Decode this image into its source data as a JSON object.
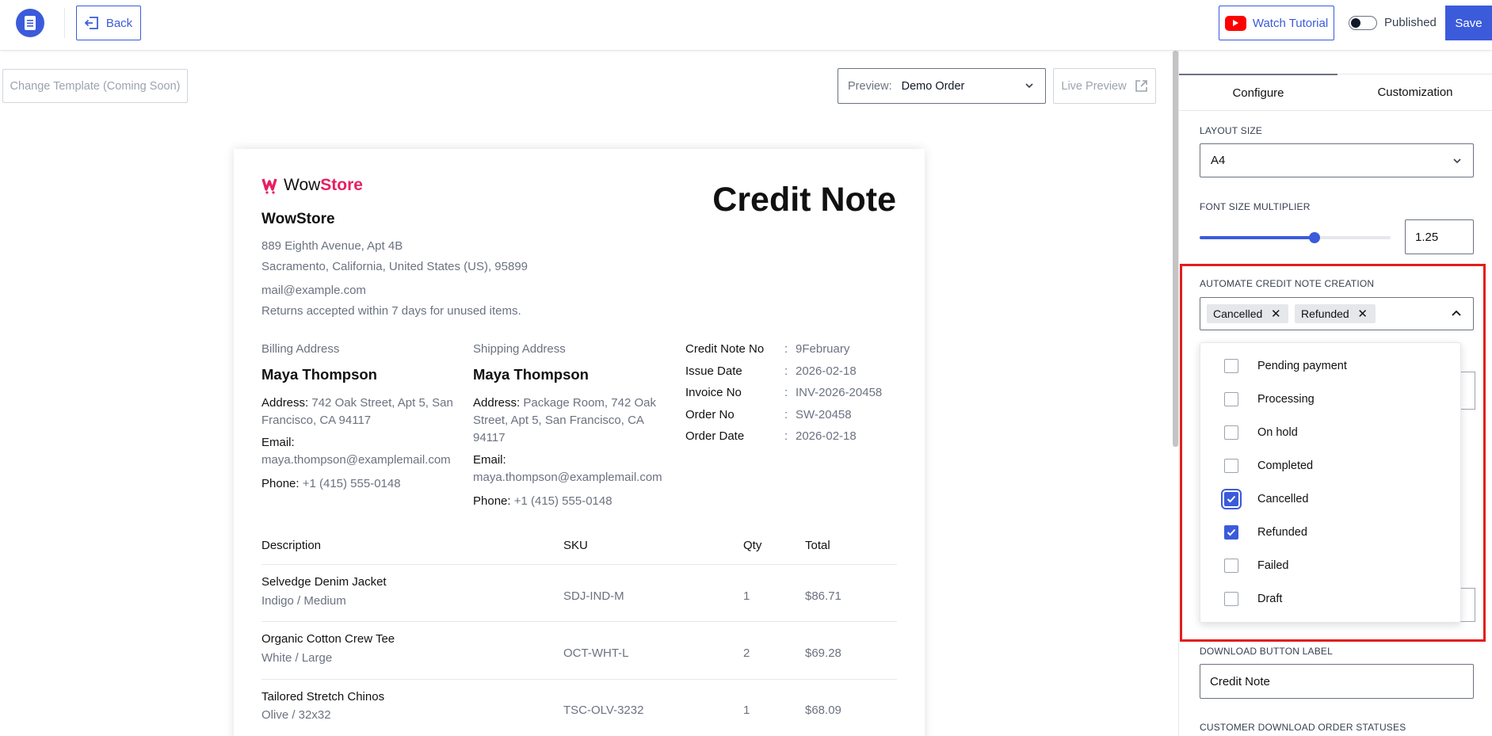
{
  "topbar": {
    "back_label": "Back",
    "watch_tutorial_label": "Watch Tutorial",
    "published_label": "Published",
    "save_label": "Save"
  },
  "toolbar": {
    "change_template_label": "Change Template (Coming Soon)",
    "preview_label": "Preview:",
    "preview_value": "Demo Order",
    "live_preview_label": "Live Preview"
  },
  "document": {
    "brand_prefix": "Wow",
    "brand_suffix": "Store",
    "title": "Credit Note",
    "store_name": "WowStore",
    "address_line1": "889 Eighth Avenue, Apt 4B",
    "address_line2": "Sacramento, California, United States (US), 95899",
    "email": "mail@example.com",
    "note": "Returns accepted within 7 days for unused items.",
    "billing": {
      "heading": "Billing Address",
      "name": "Maya Thompson",
      "address_key": "Address:",
      "address_line1": "742 Oak Street, Apt 5, San",
      "address_line2": "Francisco, CA 94117",
      "email_key": "Email:",
      "email": "maya.thompson@examplemail.com",
      "phone_key": "Phone:",
      "phone": "+1 (415) 555-0148"
    },
    "shipping": {
      "heading": "Shipping Address",
      "name": "Maya Thompson",
      "address_key": "Address:",
      "address_line1": "Package Room, 742 Oak",
      "address_line2": "Street, Apt 5, San Francisco, CA",
      "address_line3": "94117",
      "email_key": "Email:",
      "email": "maya.thompson@examplemail.com",
      "phone_key": "Phone:",
      "phone": "+1 (415) 555-0148"
    },
    "meta": [
      {
        "label": "Credit Note No",
        "sep": ":",
        "value": "9February"
      },
      {
        "label": "Issue Date",
        "sep": ":",
        "value": "2026-02-18"
      },
      {
        "label": "Invoice No",
        "sep": ":",
        "value": "INV-2026-20458"
      },
      {
        "label": "Order No",
        "sep": ":",
        "value": "SW-20458"
      },
      {
        "label": "Order Date",
        "sep": ":",
        "value": "2026-02-18"
      }
    ],
    "table": {
      "headers": [
        "Description",
        "SKU",
        "Qty",
        "Total"
      ],
      "rows": [
        {
          "name": "Selvedge Denim Jacket",
          "variant": "Indigo / Medium",
          "sku": "SDJ-IND-M",
          "qty": "1",
          "total": "$86.71"
        },
        {
          "name": "Organic Cotton Crew Tee",
          "variant": "White / Large",
          "sku": "OCT-WHT-L",
          "qty": "2",
          "total": "$69.28"
        },
        {
          "name": "Tailored Stretch Chinos",
          "variant": "Olive / 32x32",
          "sku": "TSC-OLV-3232",
          "qty": "1",
          "total": "$68.09"
        }
      ]
    }
  },
  "panel": {
    "tabs": [
      {
        "label": "Configure"
      },
      {
        "label": "Customization"
      }
    ],
    "layout_size_label": "LAYOUT SIZE",
    "layout_size_value": "A4",
    "font_size_label": "FONT SIZE MULTIPLIER",
    "font_size_value": "1.25",
    "font_size_slider_fraction": 0.6,
    "automate_label": "AUTOMATE CREDIT NOTE CREATION",
    "selected_chips": [
      "Cancelled",
      "Refunded"
    ],
    "status_options": [
      {
        "label": "Pending payment",
        "checked": false
      },
      {
        "label": "Processing",
        "checked": false
      },
      {
        "label": "On hold",
        "checked": false
      },
      {
        "label": "Completed",
        "checked": false
      },
      {
        "label": "Cancelled",
        "checked": true
      },
      {
        "label": "Refunded",
        "checked": true
      },
      {
        "label": "Failed",
        "checked": false
      },
      {
        "label": "Draft",
        "checked": false
      }
    ],
    "download_label": "DOWNLOAD BUTTON LABEL",
    "download_value": "Credit Note",
    "customer_statuses_label": "CUSTOMER DOWNLOAD ORDER STATUSES"
  },
  "colors": {
    "accent": "#3b5bdb",
    "brand_pink": "#e91e63",
    "highlight_red": "#e11d1d"
  }
}
